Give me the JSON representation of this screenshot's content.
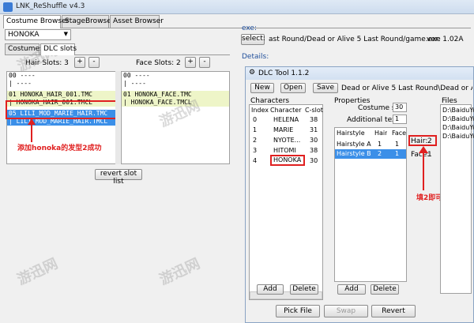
{
  "app": {
    "title": "LNK_ReShuffle v4.3"
  },
  "main_tabs": [
    {
      "label": "Costume Browser",
      "active": true
    },
    {
      "label": "StageBrowser",
      "active": false
    },
    {
      "label": "Asset Browser",
      "active": false
    }
  ],
  "left": {
    "character_select": "HONOKA",
    "sub_tabs": [
      {
        "label": "Costumes",
        "active": false
      },
      {
        "label": "DLC slots",
        "active": true
      }
    ],
    "hair": {
      "label": "Hair Slots: 3",
      "plus": "+",
      "minus": "-",
      "rows": [
        "00  ----",
        "|    ----",
        "01  HONOKA_HAIR_001.TMC",
        "|    HONOKA_HAIR_001.TMCL",
        "05  LILI_MOD_MARIE_HAIR.TMC",
        "|    LILI_MOD_MARIE_HAIR.TMCL"
      ]
    },
    "face": {
      "label": "Face Slots: 2",
      "plus": "+",
      "minus": "-",
      "rows": [
        "00  ----",
        "|    ----",
        "01  HONOKA_FACE.TMC",
        "|    HONOKA_FACE.TMCL"
      ]
    },
    "annotation": "添加honoka的发型2成功",
    "revert_slot_list": "revert slot list"
  },
  "right": {
    "exe_label": "exe:",
    "select_button": "select:",
    "exe_path": "ast Round/Dead or Alive 5 Last Round/game.exe",
    "version": "ver: 1.02A",
    "details_label": "Details:"
  },
  "dlc_tool": {
    "title": "DLC Tool 1.1.2",
    "toolbar": {
      "new": "New",
      "open": "Open",
      "save": "Save",
      "path": "Dead or Alive 5 Last Round\\Dead or Alive 5 Last Round\\"
    },
    "characters": {
      "label": "Characters",
      "headers": [
        "Index",
        "Character",
        "C-slot"
      ],
      "rows": [
        {
          "index": "0",
          "character": "HELENA",
          "cslot": "38"
        },
        {
          "index": "1",
          "character": "MARIE",
          "cslot": "31"
        },
        {
          "index": "2",
          "character": "NYOTE...",
          "cslot": "30"
        },
        {
          "index": "3",
          "character": "HITOMI",
          "cslot": "38"
        },
        {
          "index": "4",
          "character": "HONOKA",
          "cslot": "30"
        }
      ],
      "add": "Add",
      "delete": "Delete"
    },
    "properties": {
      "label": "Properties",
      "costume_slot_label": "Costume slc",
      "costume_slot_value": "30",
      "additional_label": "Additional textu",
      "additional_value": "1",
      "headers": [
        "Hairstyle",
        "Hair",
        "Face"
      ],
      "rows": [
        {
          "name": "Hairstyle A",
          "hair": "1",
          "face": "1"
        },
        {
          "name": "Hairstyle B",
          "hair": "2",
          "face": "1"
        }
      ],
      "hair_label": "Hair:",
      "hair_value": "2",
      "face_label": "Face:",
      "face_value": "1",
      "add": "Add",
      "delete": "Delete"
    },
    "files": {
      "label": "Files",
      "rows": [
        "D:\\BaiduYu",
        "D:\\BaiduYu",
        "D:\\BaiduYu",
        "D:\\BaiduYu"
      ]
    },
    "bottom": {
      "pick_file": "Pick File",
      "swap": "Swap",
      "revert": "Revert"
    },
    "annotation": "填2即可"
  },
  "watermarks": [
    "游迅网",
    "游迅网",
    "游迅网",
    "游迅网"
  ],
  "colors": {
    "annotation": "#e02020",
    "selected": "#3b8fe8",
    "highlight": "#eef5c8"
  }
}
